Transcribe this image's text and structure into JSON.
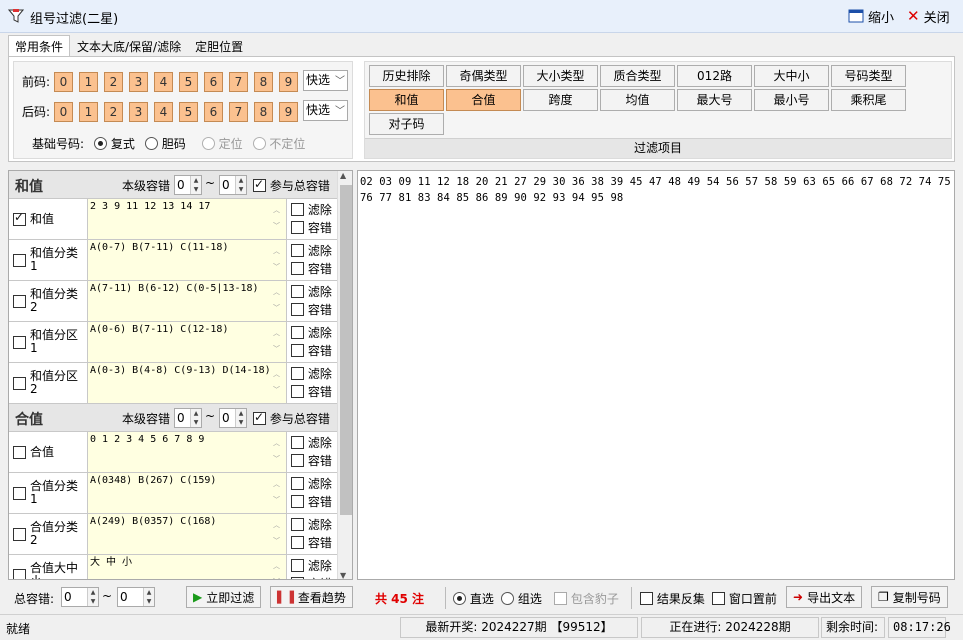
{
  "title": "组号过滤(二星)",
  "title_buttons": {
    "minimize": "缩小",
    "close": "关闭"
  },
  "tabs": [
    "常用条件",
    "文本大底/保留/滤除",
    "定胆位置"
  ],
  "front_label": "前码:",
  "back_label": "后码:",
  "digits": [
    "0",
    "1",
    "2",
    "3",
    "4",
    "5",
    "6",
    "7",
    "8",
    "9"
  ],
  "quick_select": "快选",
  "base_label": "基础号码:",
  "base_options": [
    "复式",
    "胆码",
    "定位",
    "不定位"
  ],
  "filter_items": {
    "row1": [
      "历史排除",
      "奇偶类型",
      "大小类型",
      "质合类型",
      "012路",
      "大中小",
      "号码类型"
    ],
    "row2": [
      "和值",
      "合值",
      "跨度",
      "均值",
      "最大号",
      "最小号",
      "乘积尾"
    ],
    "row3": [
      "对子码"
    ],
    "caption": "过滤项目"
  },
  "group1": {
    "title": "和值",
    "tol_label": "本级容错",
    "min": "0",
    "max": "0",
    "tilde": "~",
    "join": "参与总容错"
  },
  "group2": {
    "title": "合值",
    "tol_label": "本级容错",
    "min": "0",
    "max": "0",
    "tilde": "~",
    "join": "参与总容错"
  },
  "opt_filter": "滤除",
  "opt_tol": "容错",
  "rows1": [
    {
      "name": "和值",
      "checked": true,
      "value": "2 3 9 11 12 13 14 17"
    },
    {
      "name": "和值分类1",
      "checked": false,
      "value": "A(0-7) B(7-11) C(11-18)"
    },
    {
      "name": "和值分类2",
      "checked": false,
      "value": "A(7-11) B(6-12) C(0-5|13-18)"
    },
    {
      "name": "和值分区1",
      "checked": false,
      "value": "A(0-6) B(7-11) C(12-18)"
    },
    {
      "name": "和值分区2",
      "checked": false,
      "value": "A(0-3) B(4-8) C(9-13) D(14-18)"
    }
  ],
  "rows2": [
    {
      "name": "合值",
      "checked": false,
      "value": "0 1 2 3 4 5 6 7 8 9"
    },
    {
      "name": "合值分类1",
      "checked": false,
      "value": "A(0348) B(267) C(159)"
    },
    {
      "name": "合值分类2",
      "checked": false,
      "value": "A(249) B(0357) C(168)"
    },
    {
      "name": "合值大中小",
      "checked": false,
      "value": "大 中 小"
    }
  ],
  "result_text": "02 03 09 11 12 18 20 21 27 29 30 36 38 39 45 47 48 49 54 56 57 58 59 63 65 66 67 68 72 74 75 76 77 81 83 84 85 86 89 90 92 93 94 95 98",
  "bottom": {
    "total_tol": "总容错:",
    "min": "0",
    "max": "0",
    "tilde": "~",
    "filter_now": "立即过滤",
    "view_trend": "查看趋势",
    "count": "共 45 注",
    "direct": "直选",
    "group": "组选",
    "include_pair": "包含豹子",
    "invert": "结果反集",
    "topmost": "窗口置前",
    "export": "导出文本",
    "copy": "复制号码"
  },
  "status": {
    "ready": "就绪",
    "latest": "最新开奖: 2024227期 【99512】",
    "current": "正在进行: 2024228期",
    "remain_label": "剩余时间:",
    "remain": "08:17:26"
  },
  "colors": {
    "accent": "#fbc18f",
    "count": "#e00000"
  }
}
